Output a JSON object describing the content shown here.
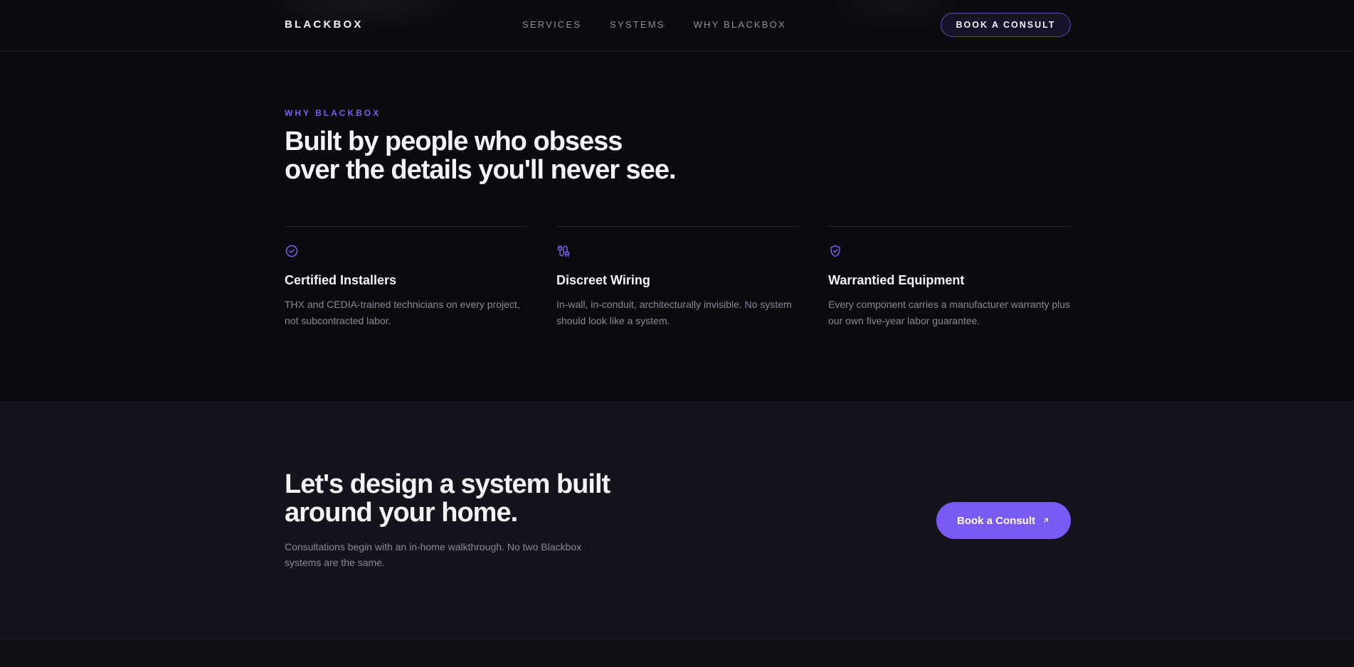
{
  "nav": {
    "logo": "BLACKBOX",
    "links": [
      "SERVICES",
      "SYSTEMS",
      "WHY BLACKBOX"
    ],
    "cta_label": "BOOK A CONSULT"
  },
  "why": {
    "eyebrow": "WHY BLACKBOX",
    "heading": "Built by people who obsess over the details you'll never see.",
    "features": [
      {
        "icon": "badge-check-icon",
        "title": "Certified Installers",
        "description": "THX and CEDIA-trained technicians on every project, not subcontracted labor."
      },
      {
        "icon": "cable-icon",
        "title": "Discreet Wiring",
        "description": "In-wall, in-conduit, architecturally invisible. No system should look like a system."
      },
      {
        "icon": "shield-check-icon",
        "title": "Warrantied Equipment",
        "description": "Every component carries a manufacturer warranty plus our own five-year labor guarantee."
      }
    ]
  },
  "cta": {
    "heading": "Let's design a system built around your home.",
    "subtext": "Consultations begin with an in-home walkthrough. No two Blackbox systems are the same.",
    "button_label": "Book a Consult",
    "button_icon": "arrow-up-right-icon"
  },
  "colors": {
    "accent": "#7a5af5",
    "eyebrow": "#7b5cf0",
    "background": "#0b0b0f",
    "cta_background": "#14141d"
  }
}
